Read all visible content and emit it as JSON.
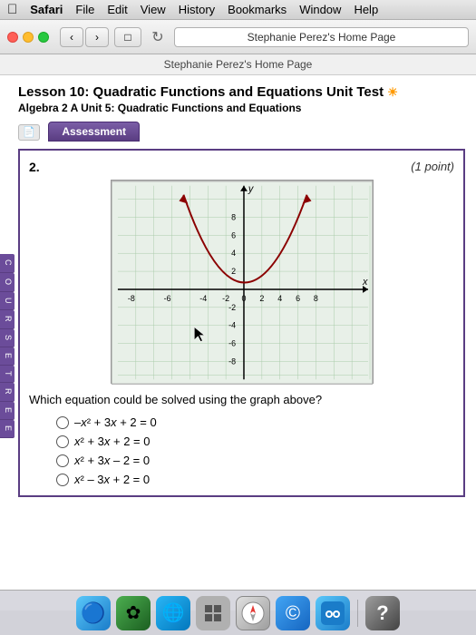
{
  "menubar": {
    "apple": "🍎",
    "items": [
      "Safari",
      "File",
      "Edit",
      "View",
      "History",
      "Bookmarks",
      "Window",
      "Help"
    ]
  },
  "toolbar": {
    "address": "Stephanie Perez's Home Page"
  },
  "page": {
    "title": "Stephanie Perez's Home Page",
    "lesson_title": "Lesson 10: Quadratic Functions and Equations Unit Test",
    "lesson_subtitle": "Algebra 2 A  Unit 5: Quadratic Functions and Equations",
    "assessment_label": "Assessment",
    "question_number": "2.",
    "point_label": "(1 point)",
    "question_text": "Which equation could be solved using the graph above?",
    "choices": [
      "–x² + 3x + 2 = 0",
      "x² + 3x + 2 = 0",
      "x² + 3x – 2 = 0",
      "x² – 3x + 2 = 0"
    ],
    "graph": {
      "x_label": "x",
      "y_label": "y",
      "x_ticks": [
        "-8",
        "-6",
        "-4",
        "-2",
        "0",
        "2",
        "4",
        "6",
        "8"
      ],
      "y_ticks": [
        "-8",
        "-6",
        "-4",
        "-2",
        "2",
        "4",
        "6",
        "8"
      ]
    }
  },
  "sidebar_tabs": [
    "C",
    "O",
    "U",
    "R",
    "S",
    "E",
    "T",
    "R",
    "E",
    "E"
  ],
  "dock": {
    "icons": [
      "finder",
      "green",
      "blue",
      "grid",
      "compass",
      "safari",
      "face",
      "help"
    ]
  }
}
